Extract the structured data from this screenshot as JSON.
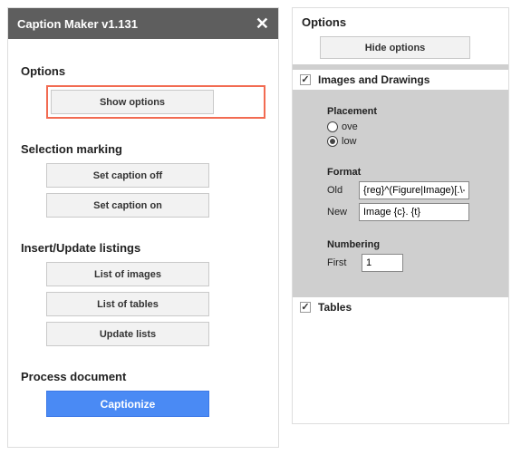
{
  "left": {
    "title": "Caption Maker v1.131",
    "sections": {
      "options": {
        "heading": "Options",
        "show": "Show options"
      },
      "selection": {
        "heading": "Selection marking",
        "off": "Set caption off",
        "on": "Set caption on"
      },
      "listings": {
        "heading": "Insert/Update listings",
        "images": "List of images",
        "tables": "List of tables",
        "update": "Update lists"
      },
      "process": {
        "heading": "Process document",
        "go": "Captionize"
      }
    }
  },
  "right": {
    "heading": "Options",
    "hide": "Hide options",
    "images_group": {
      "title": "Images and Drawings",
      "checked": true,
      "placement": {
        "label": "Placement",
        "above_partial": "ove",
        "below_partial": "low",
        "selected": "below"
      },
      "format": {
        "label": "Format",
        "old_label": "Old",
        "old_value": "{reg}^(Figure|Image)[.\\-\\",
        "new_label": "New",
        "new_value": "Image {c}. {t}"
      },
      "numbering": {
        "label": "Numbering",
        "first_label": "First",
        "first_value": "1"
      }
    },
    "tables_group": {
      "title": "Tables",
      "checked": true
    }
  }
}
